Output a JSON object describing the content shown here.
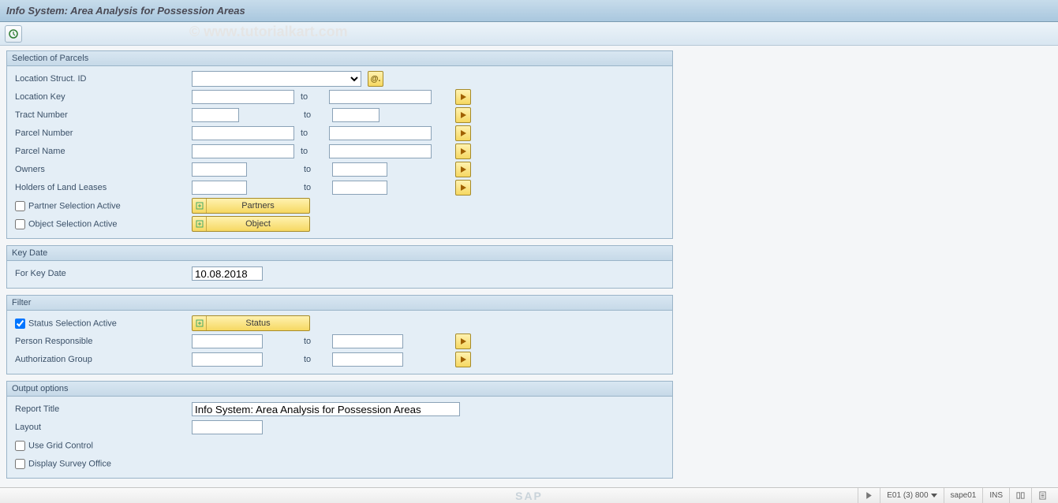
{
  "title": "Info System: Area Analysis for Possession Areas",
  "watermark": "© www.tutorialkart.com",
  "groups": {
    "parcels": {
      "title": "Selection of Parcels",
      "loc_struct_id_label": "Location Struct. ID",
      "location_key_label": "Location Key",
      "tract_number_label": "Tract Number",
      "parcel_number_label": "Parcel Number",
      "parcel_name_label": "Parcel Name",
      "owners_label": "Owners",
      "holders_label": "Holders of Land Leases",
      "partner_sel_label": "Partner Selection Active",
      "object_sel_label": "Object Selection Active",
      "to_label": "to",
      "partners_btn": "Partners",
      "object_btn": "Object"
    },
    "keydate": {
      "title": "Key Date",
      "for_key_date_label": "For Key Date",
      "for_key_date_value": "10.08.2018"
    },
    "filter": {
      "title": "Filter",
      "status_sel_label": "Status Selection Active",
      "status_btn": "Status",
      "person_resp_label": "Person Responsible",
      "auth_group_label": "Authorization Group",
      "to_label": "to"
    },
    "output": {
      "title": "Output options",
      "report_title_label": "Report Title",
      "report_title_value": "Info System: Area Analysis for Possession Areas",
      "layout_label": "Layout",
      "use_grid_label": "Use Grid Control",
      "display_survey_label": "Display Survey Office"
    }
  },
  "statusbar": {
    "sap": "SAP",
    "system": "E01 (3) 800",
    "server": "sape01",
    "mode": "INS"
  }
}
